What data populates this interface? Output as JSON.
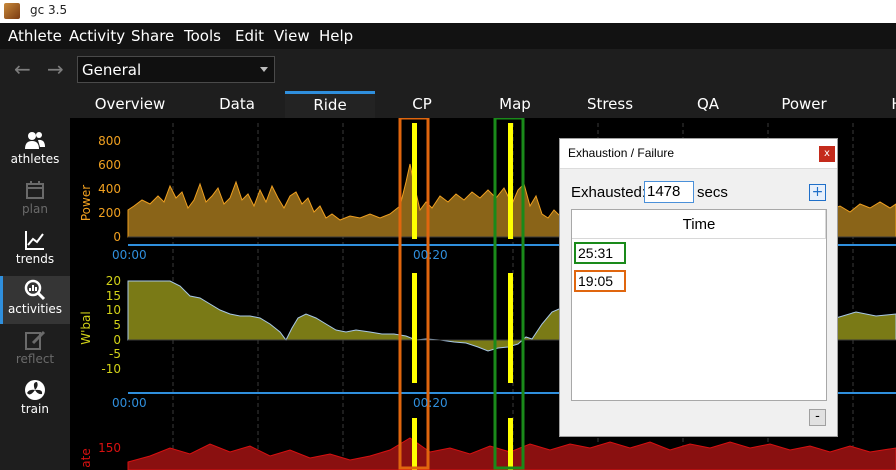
{
  "window": {
    "title": "gc 3.5"
  },
  "menu": [
    "Athlete",
    "Activity",
    "Share",
    "Tools",
    "Edit",
    "View",
    "Help"
  ],
  "toolbar": {
    "back": "←",
    "forward": "→",
    "athlete_select": "General"
  },
  "tabs": [
    "Overview",
    "Data",
    "Ride",
    "CP",
    "Map",
    "Stress",
    "QA",
    "Power",
    "H"
  ],
  "active_tab": "Ride",
  "sidebar": [
    {
      "label": "athletes",
      "icon": "athletes-icon",
      "state": "normal"
    },
    {
      "label": "plan",
      "icon": "calendar-icon",
      "state": "disabled"
    },
    {
      "label": "trends",
      "icon": "trends-chart-icon",
      "state": "normal"
    },
    {
      "label": "activities",
      "icon": "magnifier-chart-icon",
      "state": "active"
    },
    {
      "label": "reflect",
      "icon": "pencil-icon",
      "state": "disabled"
    },
    {
      "label": "train",
      "icon": "fan-icon",
      "state": "normal"
    }
  ],
  "charts": {
    "power": {
      "ylabel": "Power",
      "ticks": [
        "800",
        "600",
        "400",
        "200",
        "0"
      ],
      "color": "#f0a020"
    },
    "wbal": {
      "ylabel": "W'bal",
      "ticks": [
        "20",
        "15",
        "10",
        "5",
        "0",
        "-5",
        "-10"
      ],
      "color": "#d2d218"
    },
    "heartrate": {
      "ylabel": "ate",
      "ticks": [
        "150"
      ],
      "color": "#d81010"
    },
    "time_axis_1": [
      "00:00",
      "00:20"
    ],
    "time_axis_2": [
      "00:00",
      "00:20"
    ]
  },
  "dialog": {
    "title": "Exhaustion / Failure",
    "close": "x",
    "exhausted_label": "Exhausted:",
    "exhausted_value": "1478",
    "unit": "secs",
    "add": "+",
    "remove": "-",
    "column": "Time",
    "rows": [
      "25:31",
      "19:05"
    ]
  },
  "colors": {
    "highlight_orange": "#e0660e",
    "highlight_green": "#1a8a1a",
    "marker_yellow": "#ffff00",
    "axis_blue": "#2f8fdd"
  }
}
